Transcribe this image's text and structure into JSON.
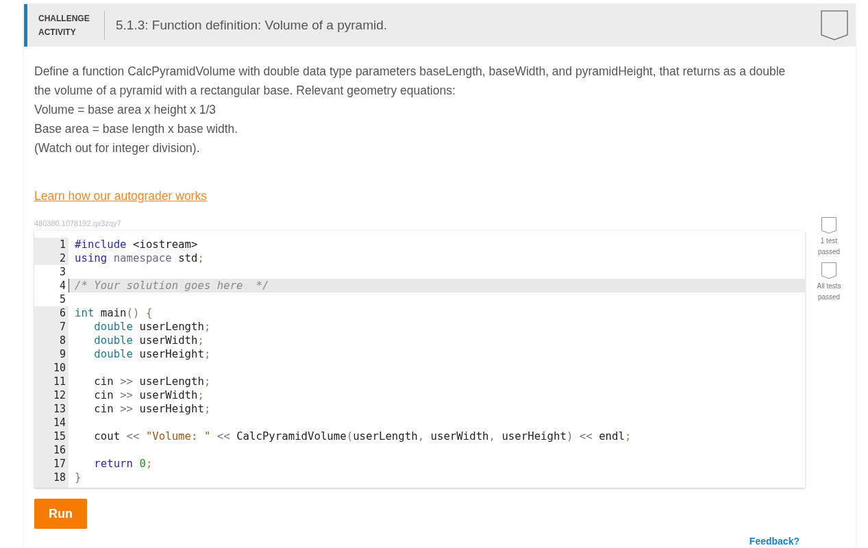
{
  "activity": {
    "label": "CHALLENGE ACTIVITY",
    "title": "5.1.3: Function definition: Volume of a pyramid.",
    "completed": false
  },
  "description": [
    "Define a function CalcPyramidVolume with double data type parameters baseLength, baseWidth, and pyramidHeight, that returns as a double the volume of a pyramid with a rectangular base. Relevant geometry equations:",
    "Volume = base area x height x 1/3",
    "Base area = base length x base width.",
    "(Watch out for integer division)."
  ],
  "autograder_link": "Learn how our autograder works",
  "activity_id": "480380.1078192.qx3zqy7",
  "editor": {
    "lines": [
      {
        "number": "1",
        "editable": false,
        "active": false,
        "tokens": [
          {
            "kind": "keyword",
            "text": "#include"
          },
          {
            "kind": "plain",
            "text": " <iostream>"
          }
        ]
      },
      {
        "number": "2",
        "editable": false,
        "active": false,
        "tokens": [
          {
            "kind": "keyword",
            "text": "using"
          },
          {
            "kind": "namespace",
            "text": " namespace"
          },
          {
            "kind": "plain",
            "text": " std"
          },
          {
            "kind": "punct",
            "text": ";"
          }
        ]
      },
      {
        "number": "3",
        "editable": true,
        "active": false
      },
      {
        "number": "4",
        "editable": true,
        "active": true,
        "tokens": [
          {
            "kind": "comment",
            "text": "/* Your solution goes here  */"
          }
        ]
      },
      {
        "number": "5",
        "editable": true,
        "active": false
      },
      {
        "number": "6",
        "editable": false,
        "active": false,
        "tokens": [
          {
            "kind": "type",
            "text": "int"
          },
          {
            "kind": "plain",
            "text": " main"
          },
          {
            "kind": "punct",
            "text": "() {"
          }
        ]
      },
      {
        "number": "7",
        "editable": false,
        "active": false,
        "tokens": [
          {
            "kind": "type",
            "text": "   double"
          },
          {
            "kind": "plain",
            "text": " userLength"
          },
          {
            "kind": "punct",
            "text": ";"
          }
        ]
      },
      {
        "number": "8",
        "editable": false,
        "active": false,
        "tokens": [
          {
            "kind": "type",
            "text": "   double"
          },
          {
            "kind": "plain",
            "text": " userWidth"
          },
          {
            "kind": "punct",
            "text": ";"
          }
        ]
      },
      {
        "number": "9",
        "editable": false,
        "active": false,
        "tokens": [
          {
            "kind": "type",
            "text": "   double"
          },
          {
            "kind": "plain",
            "text": " userHeight"
          },
          {
            "kind": "punct",
            "text": ";"
          }
        ]
      },
      {
        "number": "10",
        "editable": false,
        "active": false
      },
      {
        "number": "11",
        "editable": false,
        "active": false,
        "tokens": [
          {
            "kind": "plain",
            "text": "   cin "
          },
          {
            "kind": "operator",
            "text": ">>"
          },
          {
            "kind": "plain",
            "text": " userLength"
          },
          {
            "kind": "punct",
            "text": ";"
          }
        ]
      },
      {
        "number": "12",
        "editable": false,
        "active": false,
        "tokens": [
          {
            "kind": "plain",
            "text": "   cin "
          },
          {
            "kind": "operator",
            "text": ">>"
          },
          {
            "kind": "plain",
            "text": " userWidth"
          },
          {
            "kind": "punct",
            "text": ";"
          }
        ]
      },
      {
        "number": "13",
        "editable": false,
        "active": false,
        "tokens": [
          {
            "kind": "plain",
            "text": "   cin "
          },
          {
            "kind": "operator",
            "text": ">>"
          },
          {
            "kind": "plain",
            "text": " userHeight"
          },
          {
            "kind": "punct",
            "text": ";"
          }
        ]
      },
      {
        "number": "14",
        "editable": false,
        "active": false
      },
      {
        "number": "15",
        "editable": false,
        "active": false,
        "tokens": [
          {
            "kind": "plain",
            "text": "   cout "
          },
          {
            "kind": "operator",
            "text": "<<"
          },
          {
            "kind": "string",
            "text": " \"Volume: \""
          },
          {
            "kind": "operator",
            "text": " <<"
          },
          {
            "kind": "plain",
            "text": " CalcPyramidVolume"
          },
          {
            "kind": "punct",
            "text": "("
          },
          {
            "kind": "plain",
            "text": "userLength"
          },
          {
            "kind": "punct",
            "text": ","
          },
          {
            "kind": "plain",
            "text": " userWidth"
          },
          {
            "kind": "punct",
            "text": ","
          },
          {
            "kind": "plain",
            "text": " userHeight"
          },
          {
            "kind": "punct",
            "text": ")"
          },
          {
            "kind": "operator",
            "text": " <<"
          },
          {
            "kind": "plain",
            "text": " endl"
          },
          {
            "kind": "punct",
            "text": ";"
          }
        ]
      },
      {
        "number": "16",
        "editable": false,
        "active": false
      },
      {
        "number": "17",
        "editable": false,
        "active": false,
        "tokens": [
          {
            "kind": "keyword",
            "text": "   return"
          },
          {
            "kind": "number",
            "text": " 0"
          },
          {
            "kind": "punct",
            "text": ";"
          }
        ]
      },
      {
        "number": "18",
        "editable": false,
        "active": false,
        "tokens": [
          {
            "kind": "punct",
            "text": "}"
          }
        ]
      }
    ]
  },
  "tests": [
    {
      "label": "1 test passed",
      "passed": false
    },
    {
      "label": "All tests passed",
      "passed": false
    }
  ],
  "run_button": "Run",
  "feedback_link": "Feedback?"
}
